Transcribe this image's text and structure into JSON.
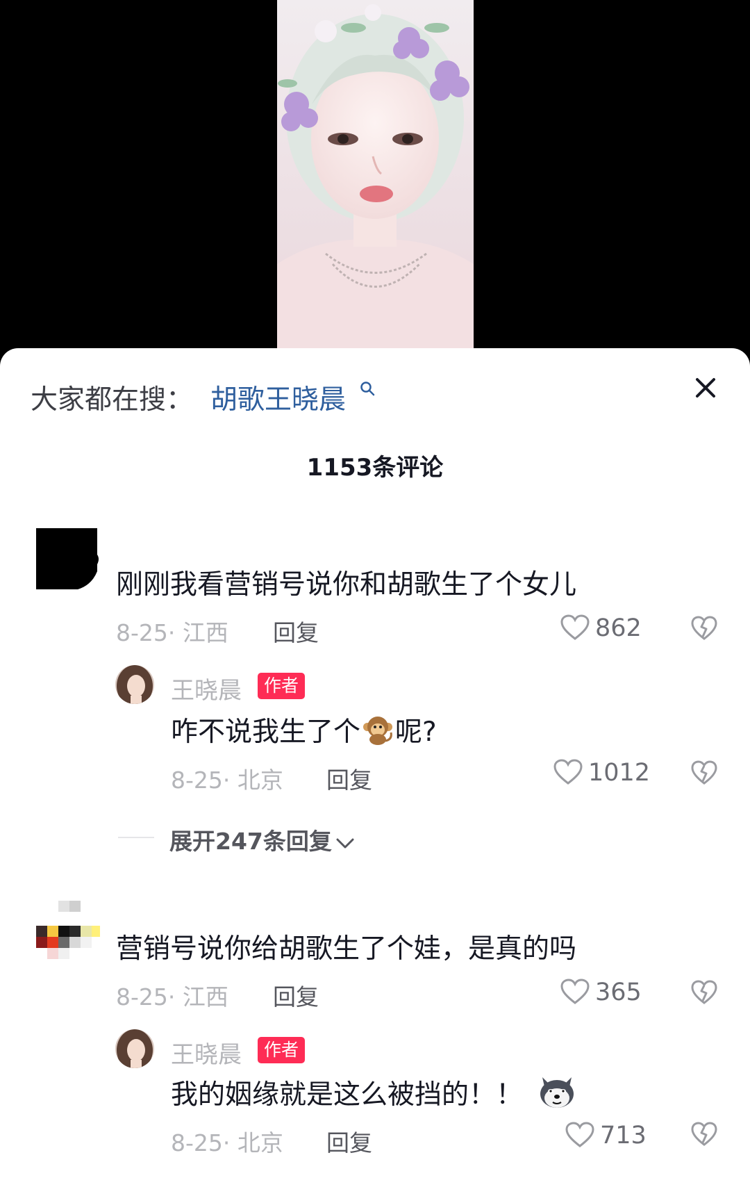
{
  "search": {
    "prefix": "大家都在搜：",
    "keyword": "胡歌王晓晨"
  },
  "comments_header": {
    "count_label": "1153条评论"
  },
  "comments": [
    {
      "text": "刚刚我看营销号说你和胡歌生了个女儿",
      "date_location": "8-25· 江西",
      "reply_label": "回复",
      "likes": "862",
      "reply": {
        "author": "王晓晨",
        "badge": "作者",
        "text": "咋不说我生了个",
        "text_after_emoji": "呢?",
        "emoji": "monkey",
        "date_location": "8-25· 北京",
        "reply_label": "回复",
        "likes": "1012"
      },
      "expand_label": "展开247条回复"
    },
    {
      "text": "营销号说你给胡歌生了个娃，是真的吗",
      "date_location": "8-25· 江西",
      "reply_label": "回复",
      "likes": "365",
      "reply": {
        "author": "王晓晨",
        "badge": "作者",
        "text": "我的姻缘就是这么被挡的！！",
        "emoji": "husky-dog",
        "date_location": "8-25· 北京",
        "reply_label": "回复",
        "likes": "713"
      }
    }
  ],
  "colors": {
    "accent": "#fe2c55",
    "search_keyword": "#2f5f9e",
    "meta_gray": "#b4b5b9",
    "text": "#161823"
  }
}
